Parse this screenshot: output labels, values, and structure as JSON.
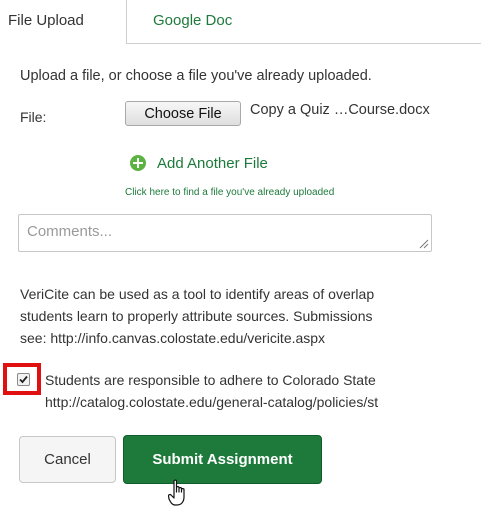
{
  "tabs": [
    {
      "label": "File Upload",
      "active": true
    },
    {
      "label": "Google Doc",
      "active": false
    }
  ],
  "upload": {
    "intro": "Upload a file, or choose a file you've already uploaded.",
    "file_label": "File:",
    "choose_button": "Choose File",
    "chosen_file": "Copy a Quiz …Course.docx",
    "add_another": "Add Another File",
    "find_hint": "Click here to find a file you've already uploaded"
  },
  "comments": {
    "placeholder": "Comments..."
  },
  "vericite": {
    "lines": [
      "VeriCite can be used as a tool to identify areas of overlap",
      "students learn to properly attribute sources. Submissions",
      "see: http://info.canvas.colostate.edu/vericite.aspx"
    ]
  },
  "terms": {
    "checked": true,
    "lines": [
      "Students are responsible to adhere to Colorado State",
      "http://catalog.colostate.edu/general-catalog/policies/st"
    ]
  },
  "actions": {
    "cancel": "Cancel",
    "submit": "Submit Assignment"
  },
  "colors": {
    "brand_green": "#1e7a3b",
    "add_icon_green": "#5bb341",
    "highlight_red": "#e01010"
  },
  "icons": {
    "add": "plus-circle-icon",
    "checkbox": "checkmark-icon",
    "cursor": "hand-pointer-icon",
    "resize": "resize-grip-icon"
  }
}
